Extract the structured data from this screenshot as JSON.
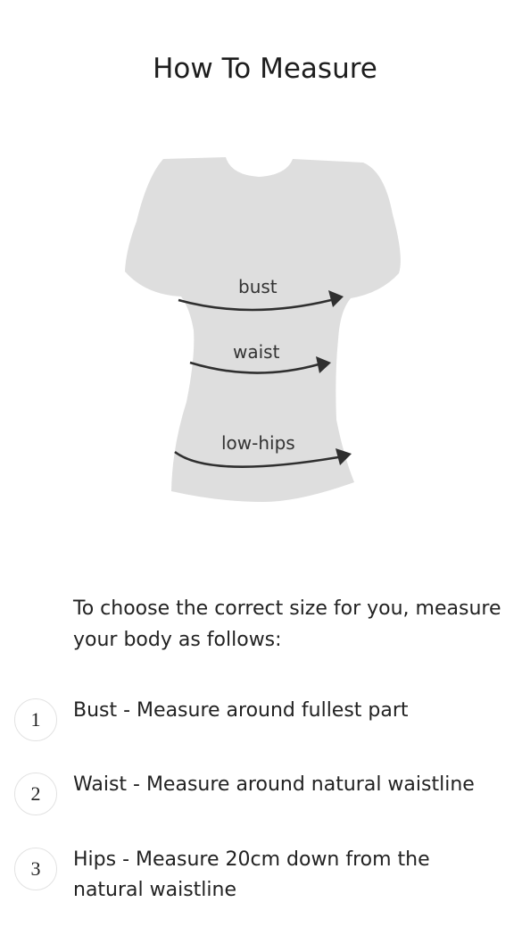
{
  "page": {
    "title": "How To Measure"
  },
  "illustration": {
    "labels": {
      "bust": "bust",
      "waist": "waist",
      "low_hips": "low-hips"
    },
    "colors": {
      "shirt": "#dedede",
      "arrow": "#2f2f2f"
    }
  },
  "intro": {
    "text": "To choose the correct size for you, measure your body as follows:"
  },
  "steps": [
    {
      "number": "1",
      "text": "Bust - Measure around fullest part"
    },
    {
      "number": "2",
      "text": "Waist - Measure around natural waistline"
    },
    {
      "number": "3",
      "text": "Hips - Measure 20cm down from the natural waistline"
    }
  ]
}
